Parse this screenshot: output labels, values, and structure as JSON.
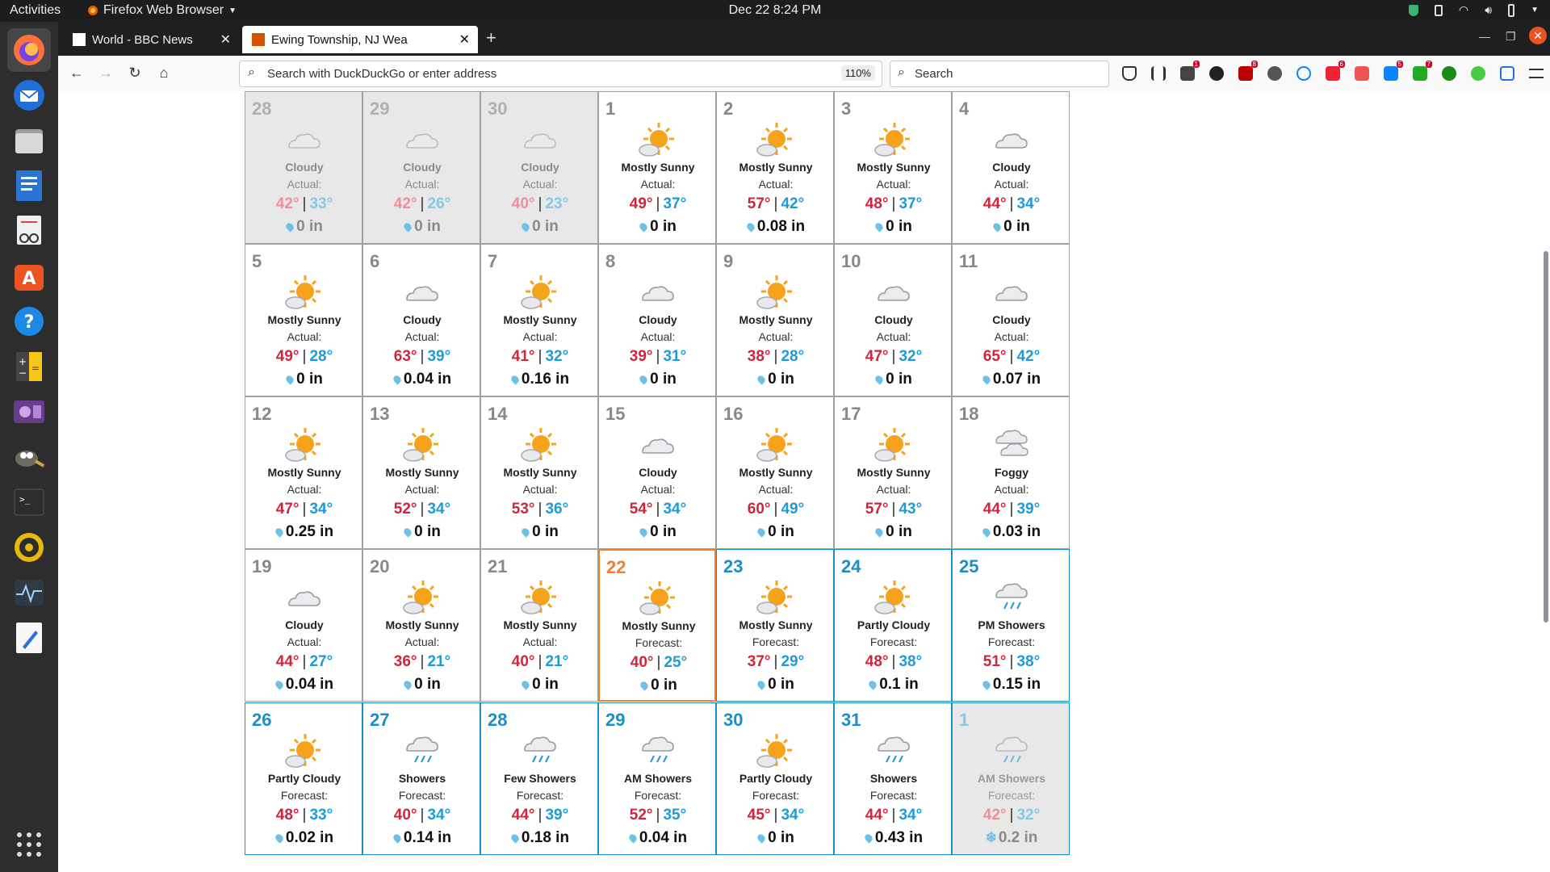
{
  "system": {
    "activities": "Activities",
    "app_name": "Firefox Web Browser",
    "clock": "Dec 22  8:24 PM"
  },
  "tabs": [
    {
      "title": "World - BBC News",
      "active": false
    },
    {
      "title": "Ewing Township, NJ Wea",
      "active": true
    }
  ],
  "navbar": {
    "url_placeholder": "Search with DuckDuckGo or enter address",
    "zoom": "110%",
    "search_placeholder": "Search"
  },
  "calendar": {
    "weeks": [
      [
        {
          "day": "28",
          "cond": "Cloudy",
          "label": "Actual:",
          "hi": "42°",
          "lo": "33°",
          "precip": "0 in",
          "icon": "cloud",
          "state": "past"
        },
        {
          "day": "29",
          "cond": "Cloudy",
          "label": "Actual:",
          "hi": "42°",
          "lo": "26°",
          "precip": "0 in",
          "icon": "cloud",
          "state": "past"
        },
        {
          "day": "30",
          "cond": "Cloudy",
          "label": "Actual:",
          "hi": "40°",
          "lo": "23°",
          "precip": "0 in",
          "icon": "cloud",
          "state": "past"
        },
        {
          "day": "1",
          "cond": "Mostly Sunny",
          "label": "Actual:",
          "hi": "49°",
          "lo": "37°",
          "precip": "0 in",
          "icon": "sun",
          "state": "actual"
        },
        {
          "day": "2",
          "cond": "Mostly Sunny",
          "label": "Actual:",
          "hi": "57°",
          "lo": "42°",
          "precip": "0.08 in",
          "icon": "sun",
          "state": "actual"
        },
        {
          "day": "3",
          "cond": "Mostly Sunny",
          "label": "Actual:",
          "hi": "48°",
          "lo": "37°",
          "precip": "0 in",
          "icon": "sun",
          "state": "actual"
        },
        {
          "day": "4",
          "cond": "Cloudy",
          "label": "Actual:",
          "hi": "44°",
          "lo": "34°",
          "precip": "0 in",
          "icon": "cloud",
          "state": "actual"
        }
      ],
      [
        {
          "day": "5",
          "cond": "Mostly Sunny",
          "label": "Actual:",
          "hi": "49°",
          "lo": "28°",
          "precip": "0 in",
          "icon": "sun",
          "state": "actual"
        },
        {
          "day": "6",
          "cond": "Cloudy",
          "label": "Actual:",
          "hi": "63°",
          "lo": "39°",
          "precip": "0.04 in",
          "icon": "cloud",
          "state": "actual"
        },
        {
          "day": "7",
          "cond": "Mostly Sunny",
          "label": "Actual:",
          "hi": "41°",
          "lo": "32°",
          "precip": "0.16 in",
          "icon": "sun",
          "state": "actual"
        },
        {
          "day": "8",
          "cond": "Cloudy",
          "label": "Actual:",
          "hi": "39°",
          "lo": "31°",
          "precip": "0 in",
          "icon": "cloud",
          "state": "actual"
        },
        {
          "day": "9",
          "cond": "Mostly Sunny",
          "label": "Actual:",
          "hi": "38°",
          "lo": "28°",
          "precip": "0 in",
          "icon": "sun",
          "state": "actual"
        },
        {
          "day": "10",
          "cond": "Cloudy",
          "label": "Actual:",
          "hi": "47°",
          "lo": "32°",
          "precip": "0 in",
          "icon": "cloud",
          "state": "actual"
        },
        {
          "day": "11",
          "cond": "Cloudy",
          "label": "Actual:",
          "hi": "65°",
          "lo": "42°",
          "precip": "0.07 in",
          "icon": "cloud",
          "state": "actual"
        }
      ],
      [
        {
          "day": "12",
          "cond": "Mostly Sunny",
          "label": "Actual:",
          "hi": "47°",
          "lo": "34°",
          "precip": "0.25 in",
          "icon": "sun",
          "state": "actual"
        },
        {
          "day": "13",
          "cond": "Mostly Sunny",
          "label": "Actual:",
          "hi": "52°",
          "lo": "34°",
          "precip": "0 in",
          "icon": "sun",
          "state": "actual"
        },
        {
          "day": "14",
          "cond": "Mostly Sunny",
          "label": "Actual:",
          "hi": "53°",
          "lo": "36°",
          "precip": "0 in",
          "icon": "sun",
          "state": "actual"
        },
        {
          "day": "15",
          "cond": "Cloudy",
          "label": "Actual:",
          "hi": "54°",
          "lo": "34°",
          "precip": "0 in",
          "icon": "cloud",
          "state": "actual"
        },
        {
          "day": "16",
          "cond": "Mostly Sunny",
          "label": "Actual:",
          "hi": "60°",
          "lo": "49°",
          "precip": "0 in",
          "icon": "sun",
          "state": "actual"
        },
        {
          "day": "17",
          "cond": "Mostly Sunny",
          "label": "Actual:",
          "hi": "57°",
          "lo": "43°",
          "precip": "0 in",
          "icon": "sun",
          "state": "actual"
        },
        {
          "day": "18",
          "cond": "Foggy",
          "label": "Actual:",
          "hi": "44°",
          "lo": "39°",
          "precip": "0.03 in",
          "icon": "fog",
          "state": "actual"
        }
      ],
      [
        {
          "day": "19",
          "cond": "Cloudy",
          "label": "Actual:",
          "hi": "44°",
          "lo": "27°",
          "precip": "0.04 in",
          "icon": "cloud",
          "state": "actual"
        },
        {
          "day": "20",
          "cond": "Mostly Sunny",
          "label": "Actual:",
          "hi": "36°",
          "lo": "21°",
          "precip": "0 in",
          "icon": "sun",
          "state": "actual"
        },
        {
          "day": "21",
          "cond": "Mostly Sunny",
          "label": "Actual:",
          "hi": "40°",
          "lo": "21°",
          "precip": "0 in",
          "icon": "sun",
          "state": "actual"
        },
        {
          "day": "22",
          "cond": "Mostly Sunny",
          "label": "Forecast:",
          "hi": "40°",
          "lo": "25°",
          "precip": "0 in",
          "icon": "sun",
          "state": "today"
        },
        {
          "day": "23",
          "cond": "Mostly Sunny",
          "label": "Forecast:",
          "hi": "37°",
          "lo": "29°",
          "precip": "0 in",
          "icon": "sun",
          "state": "forecast"
        },
        {
          "day": "24",
          "cond": "Partly Cloudy",
          "label": "Forecast:",
          "hi": "48°",
          "lo": "38°",
          "precip": "0.1 in",
          "icon": "sun",
          "state": "forecast"
        },
        {
          "day": "25",
          "cond": "PM Showers",
          "label": "Forecast:",
          "hi": "51°",
          "lo": "38°",
          "precip": "0.15 in",
          "icon": "rain",
          "state": "forecast"
        }
      ],
      [
        {
          "day": "26",
          "cond": "Partly Cloudy",
          "label": "Forecast:",
          "hi": "48°",
          "lo": "33°",
          "precip": "0.02 in",
          "icon": "sun",
          "state": "forecast"
        },
        {
          "day": "27",
          "cond": "Showers",
          "label": "Forecast:",
          "hi": "40°",
          "lo": "34°",
          "precip": "0.14 in",
          "icon": "rain",
          "state": "forecast"
        },
        {
          "day": "28",
          "cond": "Few Showers",
          "label": "Forecast:",
          "hi": "44°",
          "lo": "39°",
          "precip": "0.18 in",
          "icon": "rain",
          "state": "forecast"
        },
        {
          "day": "29",
          "cond": "AM Showers",
          "label": "Forecast:",
          "hi": "52°",
          "lo": "35°",
          "precip": "0.04 in",
          "icon": "rain",
          "state": "forecast"
        },
        {
          "day": "30",
          "cond": "Partly Cloudy",
          "label": "Forecast:",
          "hi": "45°",
          "lo": "34°",
          "precip": "0 in",
          "icon": "sun",
          "state": "forecast"
        },
        {
          "day": "31",
          "cond": "Showers",
          "label": "Forecast:",
          "hi": "44°",
          "lo": "34°",
          "precip": "0.43 in",
          "icon": "rain",
          "state": "forecast"
        },
        {
          "day": "1",
          "cond": "AM Showers",
          "label": "Forecast:",
          "hi": "42°",
          "lo": "32°",
          "precip": "0.2 in",
          "icon": "rain",
          "state": "future",
          "snow": true
        }
      ]
    ]
  },
  "colors": {
    "high_temp": "#d0253c",
    "low_temp": "#1f9ad6",
    "forecast_border": "#1b8ec7",
    "today_border": "#f08030",
    "actual_border": "#a0a0a0"
  }
}
